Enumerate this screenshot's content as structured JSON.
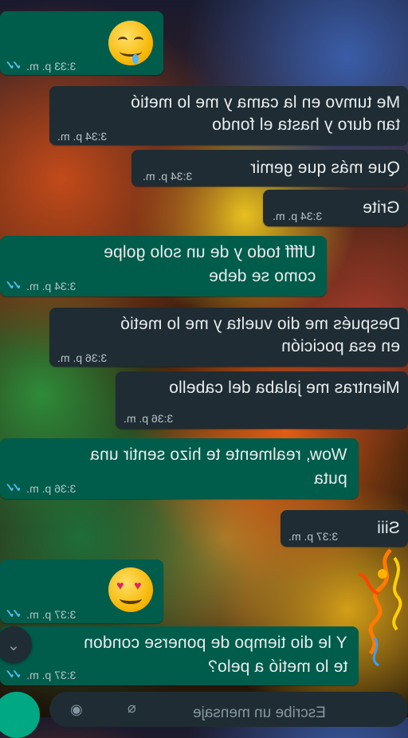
{
  "messages": [
    {
      "text": "",
      "time": "3:33 p. m.",
      "emoji": "drooling-face",
      "type": "sent"
    },
    {
      "line1": "Me tumvo en la cama y me lo metió",
      "line2": "tan duro y hasta el fondo",
      "time": "3:34 p. m.",
      "type": "received"
    },
    {
      "line1": "Que más que gemir",
      "time": "3:34 p. m.",
      "type": "received"
    },
    {
      "line1": "Grite",
      "time": "3:34 p. m.",
      "type": "received"
    },
    {
      "line1": "Uffff todo y de un solo golpe",
      "line2": "como se debe",
      "time": "3:34 p. m.",
      "type": "sent"
    },
    {
      "line1": "Después me dio vuelta y me lo metió",
      "line2": "en esa pocición",
      "time": "3:36 p. m.",
      "type": "received"
    },
    {
      "line1": "Mientras me jalaba del cabello",
      "time": "3:36 p. m.",
      "type": "received"
    },
    {
      "line1": "Wow, realmente te hizo sentir una",
      "line2": "puta",
      "time": "3:36 p. m.",
      "type": "sent"
    },
    {
      "line1": "Siii",
      "time": "3:37 p. m.",
      "type": "received"
    },
    {
      "text": "",
      "time": "3:37 p. m.",
      "emoji": "heart-eyes-face",
      "type": "sent"
    },
    {
      "line1": "Y le dio tiempo de ponerse condon",
      "line2": "te lo metió a pelo?",
      "time": "3:37 p. m.",
      "type": "sent"
    }
  ],
  "input": {
    "placeholder": "Escribe un mensaje"
  },
  "icons": {
    "read": "double-check-icon",
    "mic": "mic-icon",
    "scroll": "chevron-double-down-icon",
    "camera": "camera-icon",
    "attach": "paperclip-icon"
  },
  "colors": {
    "sent": "#005c4b",
    "received": "#1f2c33",
    "accent": "#00a884",
    "read_ticks": "#53bdeb"
  }
}
